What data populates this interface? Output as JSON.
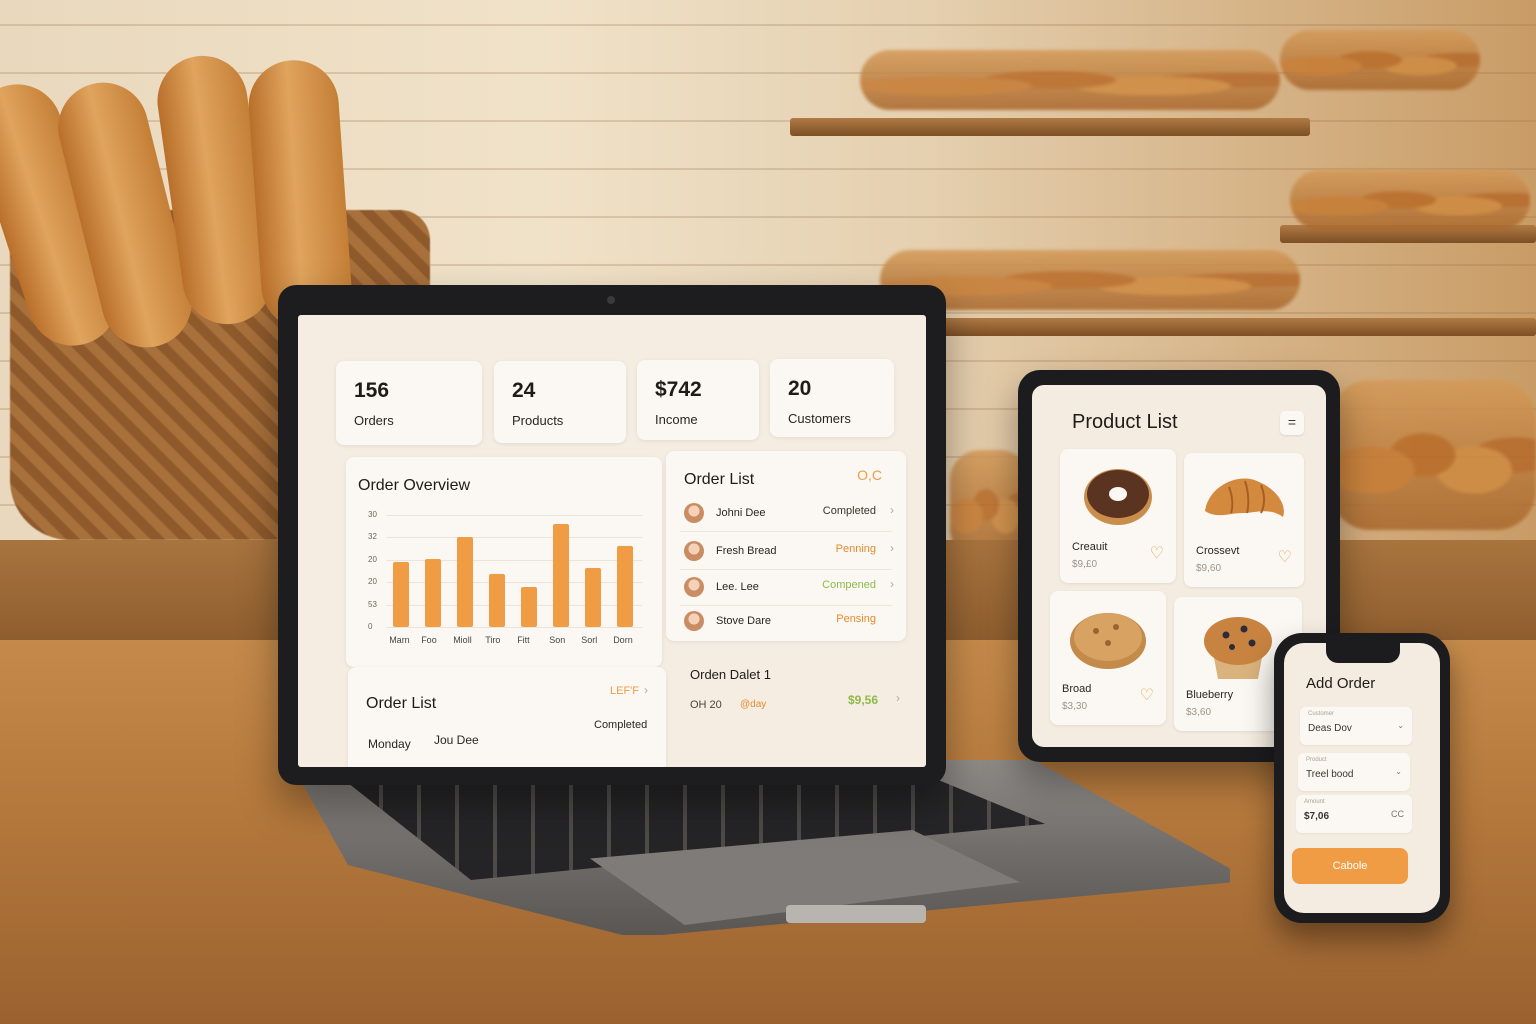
{
  "laptop": {
    "stats": [
      {
        "value": "156",
        "label": "Orders"
      },
      {
        "value": "24",
        "label": "Products"
      },
      {
        "value": "$742",
        "label": "Income"
      },
      {
        "value": "20",
        "label": "Customers"
      }
    ],
    "order_overview": {
      "title": "Order Overview",
      "y_ticks": [
        "30",
        "32",
        "20",
        "20",
        "53",
        "0"
      ],
      "x_ticks": [
        "Marn",
        "Foo",
        "Mioll",
        "Tiro",
        "Fitt",
        "Son",
        "Sorl",
        "Dorn"
      ]
    },
    "order_list_panel": {
      "title": "Order List",
      "action": "O,C",
      "rows": [
        {
          "name": "Johni Dee",
          "status": "Completed",
          "status_color": "#3a342d"
        },
        {
          "name": "Fresh Bread",
          "status": "Penning",
          "status_color": "#e68a2e"
        },
        {
          "name": "Lee. Lee",
          "status": "Compened",
          "status_color": "#8dbb4a"
        },
        {
          "name": "Stove Dare",
          "status": "Pensing",
          "status_color": "#e68a2e"
        }
      ]
    },
    "order_detail": {
      "title": "Orden Dalet 1",
      "date": "OH 20",
      "tag": "@day",
      "amount": "$9,56"
    },
    "order_list_bottom": {
      "title": "Order List",
      "action": "LEF'F",
      "day": "Monday",
      "name": "Jou Dee",
      "status": "Completed"
    }
  },
  "tablet": {
    "title": "Product List",
    "menu_icon": "menu-icon",
    "products": [
      {
        "name": "Creauit",
        "price": "$9,£0",
        "icon": "donut-icon"
      },
      {
        "name": "Crossevt",
        "price": "$9,60",
        "icon": "croissant-icon"
      },
      {
        "name": "Broad",
        "price": "$3,30",
        "icon": "bread-icon"
      },
      {
        "name": "Blueberry",
        "price": "$3,60",
        "icon": "muffin-icon"
      }
    ]
  },
  "phone": {
    "title": "Add Order",
    "fields": [
      {
        "mini": "Customer",
        "value": "Deas Dov"
      },
      {
        "mini": "Product",
        "value": "Treel bood"
      },
      {
        "mini": "Amount",
        "value": "$7,06",
        "suffix": "CC"
      }
    ],
    "button": "Cabole"
  },
  "colors": {
    "accent": "#ef9c45",
    "pending": "#e68a2e",
    "completed_green": "#8dbb4a"
  },
  "chart_data": {
    "type": "bar",
    "categories": [
      "Marn",
      "Foo",
      "Mioll",
      "Tiro",
      "Fitt",
      "Son",
      "Sorl",
      "Dorn"
    ],
    "values": [
      21,
      22,
      29,
      17,
      13,
      33,
      19,
      26
    ],
    "ylim": [
      0,
      36
    ],
    "grid": true,
    "legend": "none"
  }
}
